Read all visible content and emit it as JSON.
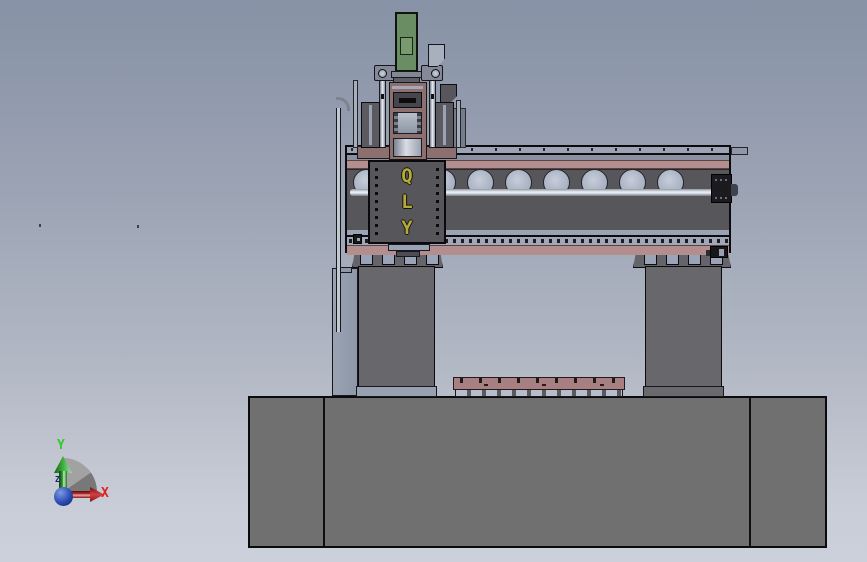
{
  "viewport": {
    "type": "cad-3d-viewport",
    "view": "side"
  },
  "model": {
    "plate_letters": [
      "Q",
      "L",
      "Y"
    ]
  },
  "triad": {
    "x": "X",
    "y": "Y",
    "z": "Z"
  },
  "colors": {
    "background_top": "#8792a6",
    "background_bottom": "#ccd0da",
    "machine_gray": "#57575b",
    "column_gray": "#67676c",
    "base_gray": "#707070",
    "rail_pink": "#b28e8e",
    "spindle_mauve": "#8c7070",
    "motor_green": "#6b8d63",
    "letter_yellow": "#b4a93e",
    "axis_x_red": "#e02020",
    "axis_y_green": "#2ecc2e",
    "axis_z_blue": "#16246e"
  }
}
